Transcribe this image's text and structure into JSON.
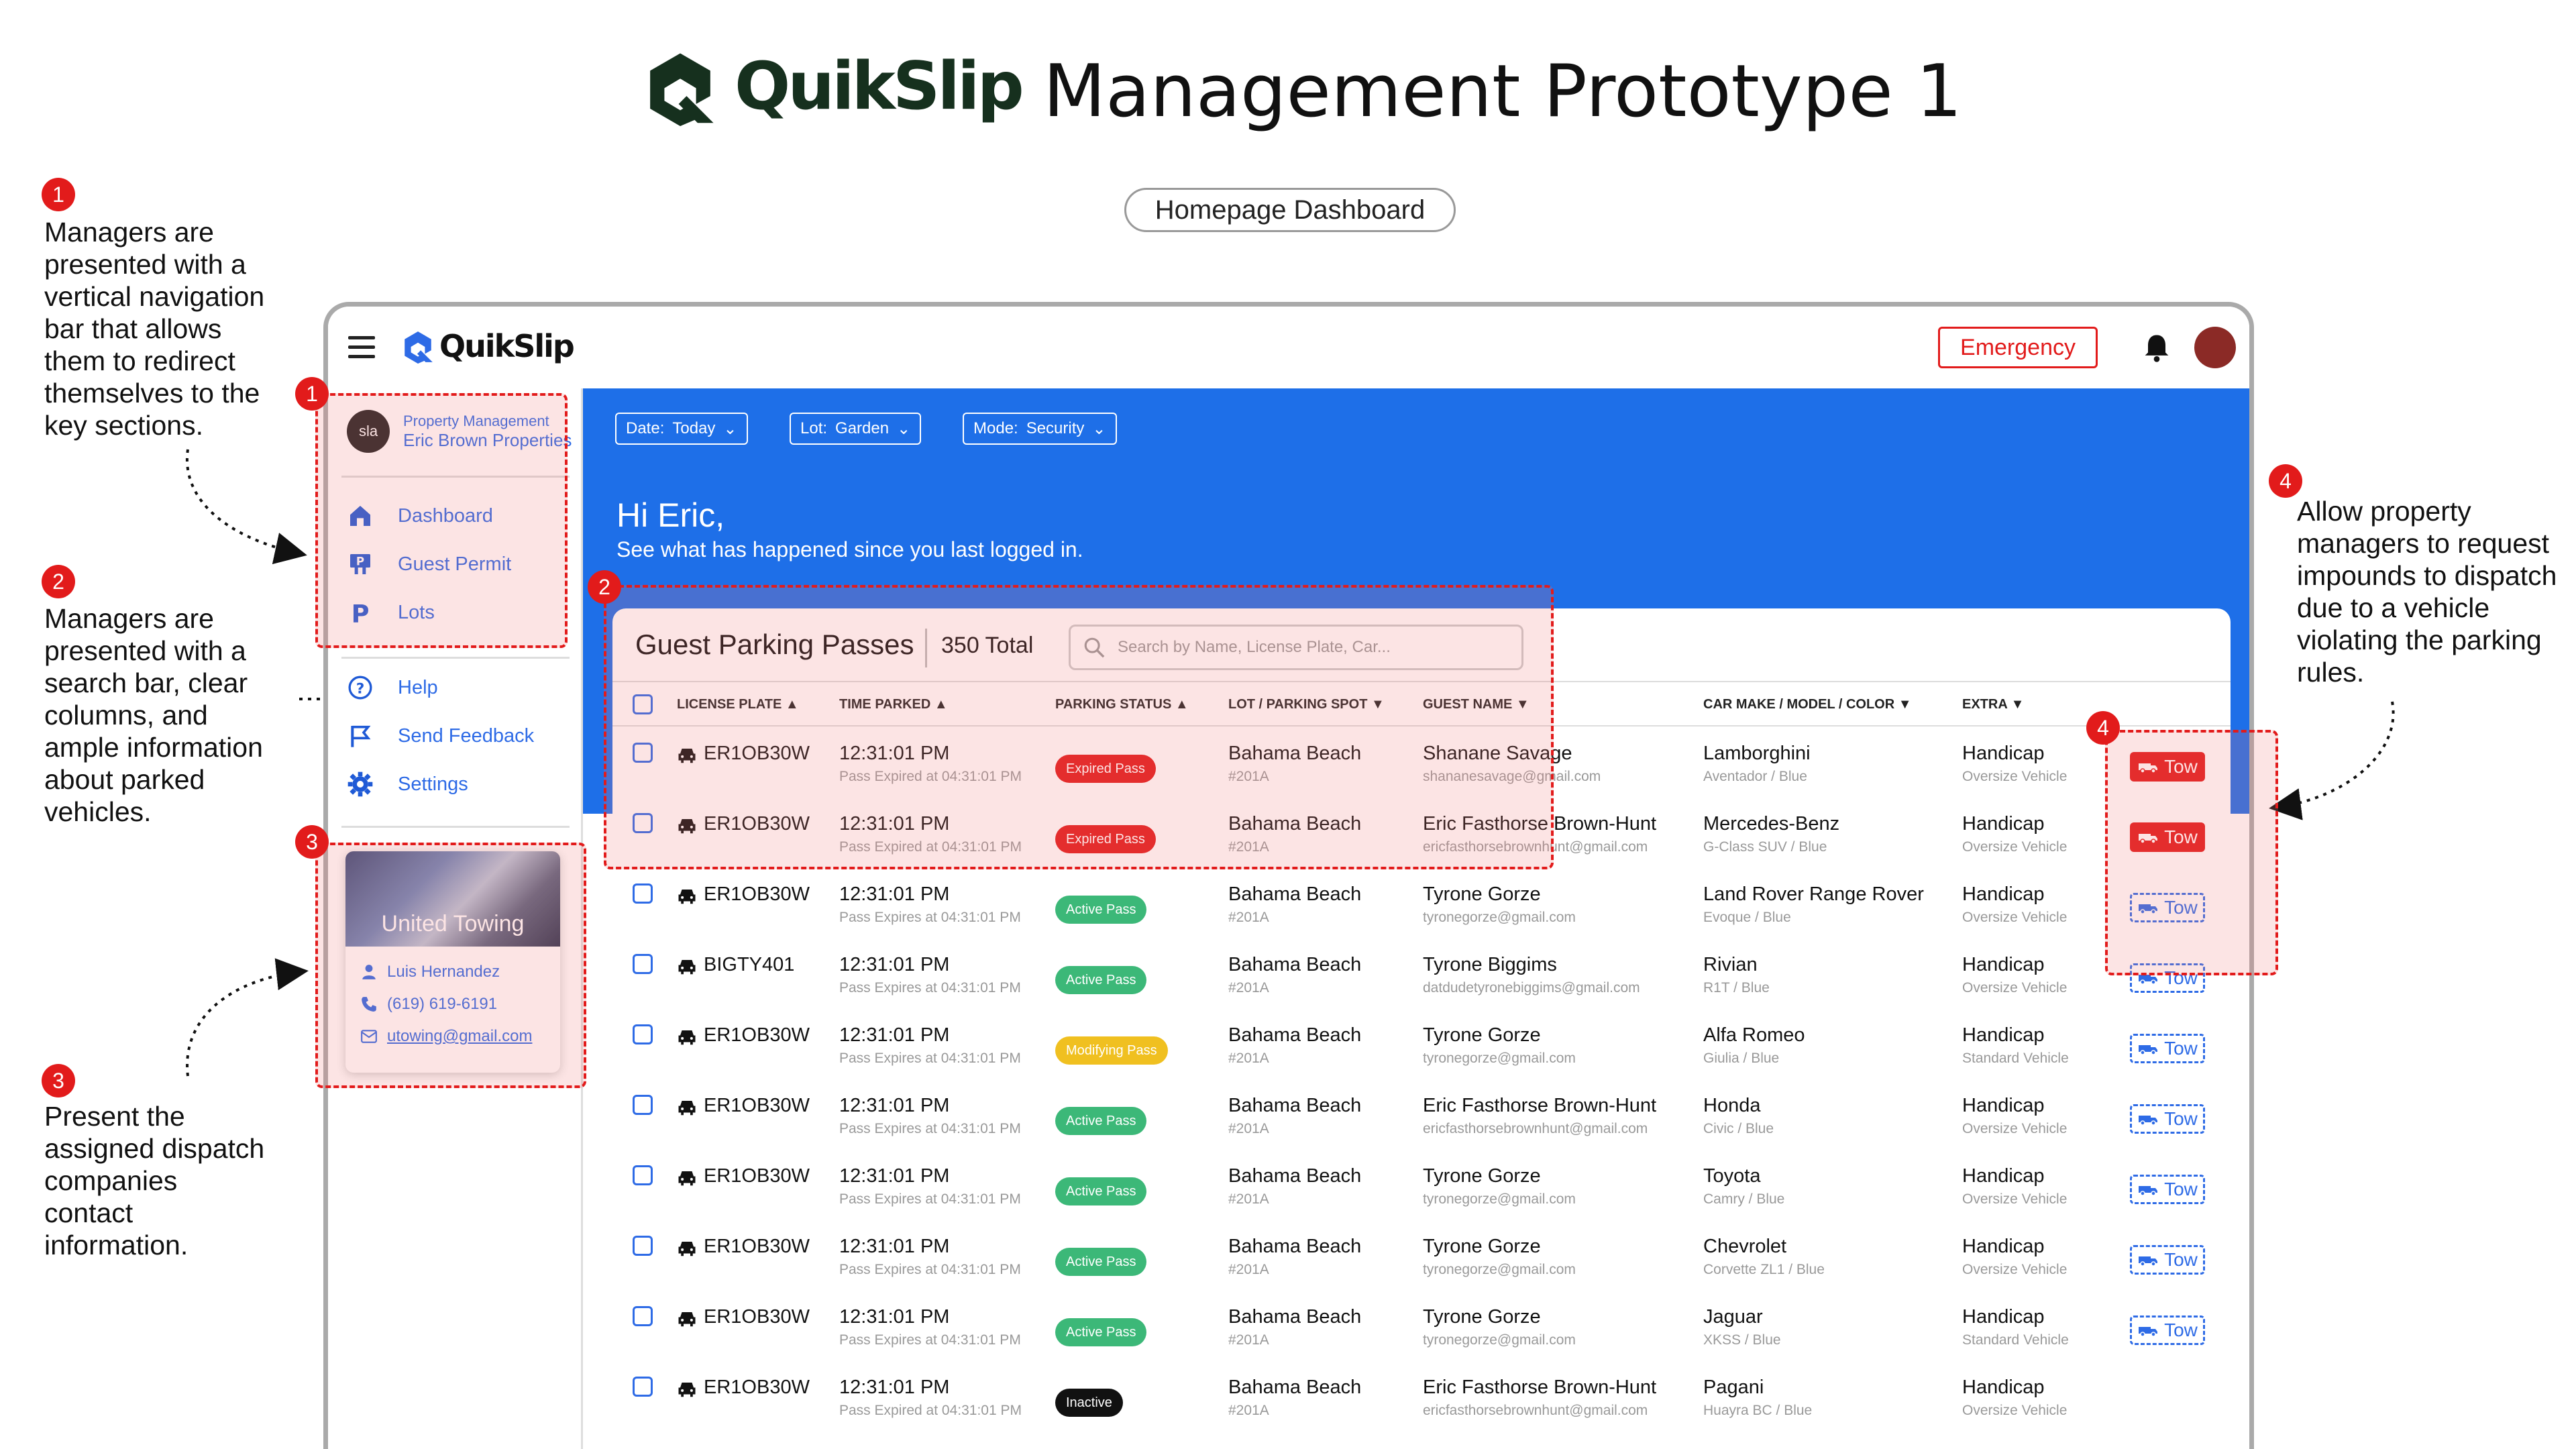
{
  "header": {
    "brand": "QuikSlip",
    "title": "Management Prototype 1",
    "page_pill": "Homepage Dashboard"
  },
  "annotations": [
    {
      "num": "1",
      "text": "Managers are\npresented with a\nvertical navigation\nbar that allows\nthem to redirect\nthemselves to the\nkey sections."
    },
    {
      "num": "2",
      "text": "Managers are\npresented with a\nsearch bar, clear\ncolumns, and\nample information\nabout parked\nvehicles."
    },
    {
      "num": "3",
      "text": "Present the\nassigned dispatch\ncompanies\ncontact\ninformation."
    },
    {
      "num": "4",
      "text": "Allow property\nmanagers to request\nimpounds to dispatch\ndue to a vehicle\nviolating the parking\nrules."
    }
  ],
  "app": {
    "brand": "QuikSlip",
    "emergency_label": "Emergency",
    "org": {
      "logo_text": "sla",
      "role": "Property Management",
      "name": "Eric Brown Properties"
    },
    "nav": [
      {
        "label": "Dashboard",
        "icon": "home-icon"
      },
      {
        "label": "Guest Permit",
        "icon": "permit-icon"
      },
      {
        "label": "Lots",
        "icon": "parking-icon"
      }
    ],
    "nav_secondary": [
      {
        "label": "Help",
        "icon": "help-icon"
      },
      {
        "label": "Send Feedback",
        "icon": "flag-icon"
      },
      {
        "label": "Settings",
        "icon": "gear-icon"
      }
    ],
    "towing": {
      "company": "United Towing",
      "contact": "Luis Hernandez",
      "phone": "(619) 619-6191",
      "email": "utowing@gmail.com"
    },
    "filters": [
      {
        "key": "Date:",
        "value": "Today"
      },
      {
        "key": "Lot:",
        "value": "Garden"
      },
      {
        "key": "Mode:",
        "value": "Security"
      }
    ],
    "greeting": "Hi Eric,",
    "greeting_sub": "See what has happened since you last logged in.",
    "table": {
      "title": "Guest Parking Passes",
      "total": "350 Total",
      "search_placeholder": "Search by Name, License Plate, Car...",
      "columns": [
        "LICENSE PLATE ▲",
        "TIME PARKED ▲",
        "PARKING STATUS ▲",
        "LOT / PARKING SPOT ▼",
        "GUEST NAME ▼",
        "CAR MAKE / MODEL / COLOR ▼",
        "EXTRA ▼"
      ],
      "tow_label": "Tow",
      "rows": [
        {
          "plate": "ER1OB30W",
          "time": "12:31:01 PM",
          "time_sub": "Pass Expired at 04:31:01 PM",
          "status": "Expired Pass",
          "status_color": "#e21b1b",
          "lot": "Bahama Beach",
          "spot": "#201A",
          "guest": "Shanane Savage",
          "email": "shananesavage@gmail.com",
          "car": "Lamborghini",
          "car_sub": "Aventador / Blue",
          "extra": "Handicap",
          "extra_sub": "Oversize Vehicle",
          "tow": "active"
        },
        {
          "plate": "ER1OB30W",
          "time": "12:31:01 PM",
          "time_sub": "Pass Expired at 04:31:01 PM",
          "status": "Expired Pass",
          "status_color": "#e21b1b",
          "lot": "Bahama Beach",
          "spot": "#201A",
          "guest": "Eric Fasthorse Brown-Hunt",
          "email": "ericfasthorsebrownhunt@gmail.com",
          "car": "Mercedes-Benz",
          "car_sub": "G-Class SUV / Blue",
          "extra": "Handicap",
          "extra_sub": "Oversize Vehicle",
          "tow": "active"
        },
        {
          "plate": "ER1OB30W",
          "time": "12:31:01 PM",
          "time_sub": "Pass Expires at 04:31:01 PM",
          "status": "Active Pass",
          "status_color": "#3cb878",
          "lot": "Bahama Beach",
          "spot": "#201A",
          "guest": "Tyrone Gorze",
          "email": "tyronegorze@gmail.com",
          "car": "Land Rover Range Rover",
          "car_sub": "Evoque / Blue",
          "extra": "Handicap",
          "extra_sub": "Oversize Vehicle",
          "tow": "idle"
        },
        {
          "plate": "BIGTY401",
          "time": "12:31:01 PM",
          "time_sub": "Pass Expires at 04:31:01 PM",
          "status": "Active Pass",
          "status_color": "#3cb878",
          "lot": "Bahama Beach",
          "spot": "#201A",
          "guest": "Tyrone Biggims",
          "email": "datdudetyronebiggims@gmail.com",
          "car": "Rivian",
          "car_sub": "R1T / Blue",
          "extra": "Handicap",
          "extra_sub": "Oversize Vehicle",
          "tow": "idle"
        },
        {
          "plate": "ER1OB30W",
          "time": "12:31:01 PM",
          "time_sub": "Pass Expires at 04:31:01 PM",
          "status": "Modifying Pass",
          "status_color": "#f0c020",
          "lot": "Bahama Beach",
          "spot": "#201A",
          "guest": "Tyrone Gorze",
          "email": "tyronegorze@gmail.com",
          "car": "Alfa Romeo",
          "car_sub": "Giulia / Blue",
          "extra": "Handicap",
          "extra_sub": "Standard Vehicle",
          "tow": "idle"
        },
        {
          "plate": "ER1OB30W",
          "time": "12:31:01 PM",
          "time_sub": "Pass Expires at 04:31:01 PM",
          "status": "Active Pass",
          "status_color": "#3cb878",
          "lot": "Bahama Beach",
          "spot": "#201A",
          "guest": "Eric Fasthorse Brown-Hunt",
          "email": "ericfasthorsebrownhunt@gmail.com",
          "car": "Honda",
          "car_sub": "Civic / Blue",
          "extra": "Handicap",
          "extra_sub": "Oversize Vehicle",
          "tow": "idle"
        },
        {
          "plate": "ER1OB30W",
          "time": "12:31:01 PM",
          "time_sub": "Pass Expires at 04:31:01 PM",
          "status": "Active Pass",
          "status_color": "#3cb878",
          "lot": "Bahama Beach",
          "spot": "#201A",
          "guest": "Tyrone Gorze",
          "email": "tyronegorze@gmail.com",
          "car": "Toyota",
          "car_sub": "Camry / Blue",
          "extra": "Handicap",
          "extra_sub": "Oversize Vehicle",
          "tow": "idle"
        },
        {
          "plate": "ER1OB30W",
          "time": "12:31:01 PM",
          "time_sub": "Pass Expires at 04:31:01 PM",
          "status": "Active Pass",
          "status_color": "#3cb878",
          "lot": "Bahama Beach",
          "spot": "#201A",
          "guest": "Tyrone Gorze",
          "email": "tyronegorze@gmail.com",
          "car": "Chevrolet",
          "car_sub": "Corvette ZL1 / Blue",
          "extra": "Handicap",
          "extra_sub": "Oversize Vehicle",
          "tow": "idle"
        },
        {
          "plate": "ER1OB30W",
          "time": "12:31:01 PM",
          "time_sub": "Pass Expires at 04:31:01 PM",
          "status": "Active Pass",
          "status_color": "#3cb878",
          "lot": "Bahama Beach",
          "spot": "#201A",
          "guest": "Tyrone Gorze",
          "email": "tyronegorze@gmail.com",
          "car": "Jaguar",
          "car_sub": "XKSS / Blue",
          "extra": "Handicap",
          "extra_sub": "Standard Vehicle",
          "tow": "idle"
        },
        {
          "plate": "ER1OB30W",
          "time": "12:31:01 PM",
          "time_sub": "Pass Expired at 04:31:01 PM",
          "status": "Inactive",
          "status_color": "#111111",
          "lot": "Bahama Beach",
          "spot": "#201A",
          "guest": "Eric Fasthorse Brown-Hunt",
          "email": "ericfasthorsebrownhunt@gmail.com",
          "car": "Pagani",
          "car_sub": "Huayra BC / Blue",
          "extra": "Handicap",
          "extra_sub": "Oversize Vehicle",
          "tow": "none"
        }
      ]
    }
  }
}
